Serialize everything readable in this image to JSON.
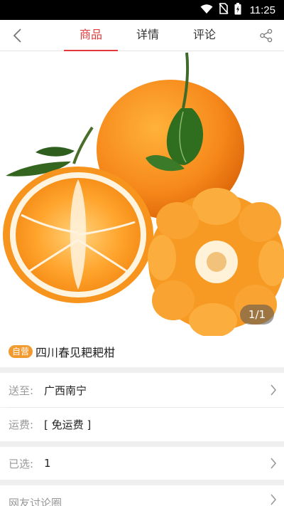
{
  "status_bar": {
    "time": "11:25"
  },
  "nav": {
    "tabs": [
      {
        "label": "商品",
        "active": true
      },
      {
        "label": "详情",
        "active": false
      },
      {
        "label": "评论",
        "active": false
      }
    ]
  },
  "gallery": {
    "pager": "1/1"
  },
  "product": {
    "badge": "自营",
    "title": "四川春见耙耙柑"
  },
  "delivery": {
    "label": "送至:",
    "value": "广西南宁"
  },
  "shipping": {
    "label": "运费:",
    "value": "[ 免运费 ]"
  },
  "selected": {
    "label": "已选:",
    "value": "1"
  },
  "forum": {
    "label": "网友讨论圈"
  },
  "colors": {
    "accent": "#e23a3a",
    "badge": "#f29a2e"
  }
}
